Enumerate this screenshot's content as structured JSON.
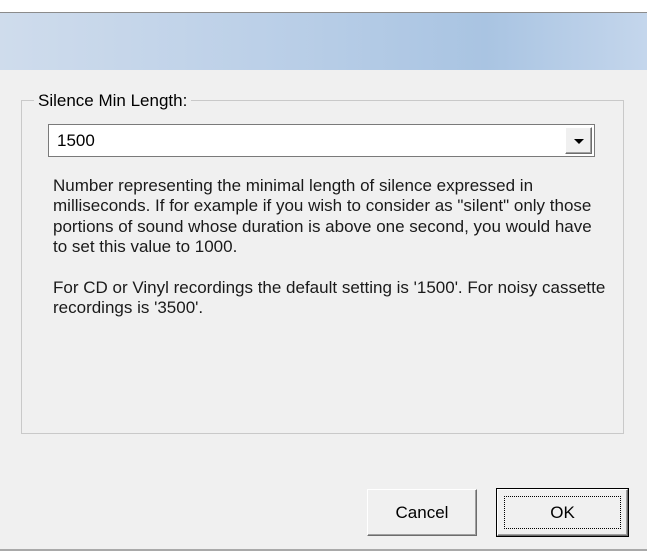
{
  "dialog": {
    "group_label": "Silence Min Length:",
    "combo_value": "1500",
    "description_1": "Number representing the minimal length of silence expressed in milliseconds. If for example if you wish to consider as \"silent\" only those portions of sound whose duration is above one second, you would have to set this value to 1000.",
    "description_2": "For CD or Vinyl recordings the default setting is '1500'. For noisy cassette recordings is '3500'.",
    "cancel_label": "Cancel",
    "ok_label": "OK"
  }
}
